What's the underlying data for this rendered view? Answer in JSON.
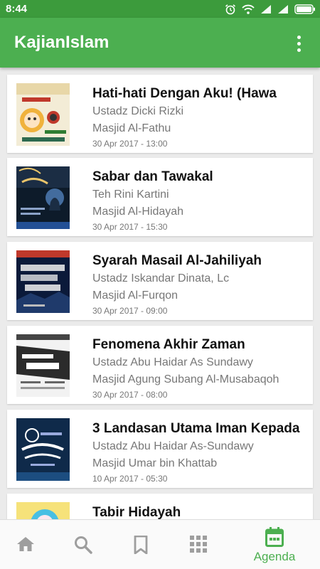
{
  "status_bar": {
    "time": "8:44"
  },
  "app_bar": {
    "title": "KajianIslam"
  },
  "events": [
    {
      "title": "Hati-hati Dengan Aku! (Hawa",
      "speaker": "Ustadz Dicki Rizki",
      "place": "Masjid Al-Fathu",
      "datetime": "30 Apr 2017 - 13:00"
    },
    {
      "title": "Sabar dan Tawakal",
      "speaker": "Teh Rini Kartini",
      "place": "Masjid Al-Hidayah",
      "datetime": "30 Apr 2017 - 15:30"
    },
    {
      "title": "Syarah Masail Al-Jahiliyah",
      "speaker": "Ustadz Iskandar Dinata, Lc",
      "place": "Masjid Al-Furqon",
      "datetime": "30 Apr 2017 - 09:00"
    },
    {
      "title": "Fenomena Akhir Zaman",
      "speaker": "Ustadz Abu Haidar As Sundawy",
      "place": "Masjid Agung Subang Al-Musabaqoh",
      "datetime": "30 Apr 2017 - 08:00"
    },
    {
      "title": "3 Landasan Utama Iman Kepada",
      "speaker": "Ustadz Abu Haidar As-Sundawy",
      "place": "Masjid Umar bin Khattab",
      "datetime": "10 Apr 2017 - 05:30"
    },
    {
      "title": "Tabir Hidayah",
      "speaker": "",
      "place": "",
      "datetime": ""
    }
  ],
  "bottom_nav": {
    "items": [
      {
        "icon": "home-icon"
      },
      {
        "icon": "search-icon"
      },
      {
        "icon": "bookmark-icon"
      },
      {
        "icon": "grid-icon"
      },
      {
        "icon": "calendar-icon",
        "label": "Agenda",
        "active": true
      }
    ]
  },
  "colors": {
    "primary": "#4caf50",
    "status_bar": "#3c9b3c",
    "inactive_icon": "#9e9e9e"
  }
}
